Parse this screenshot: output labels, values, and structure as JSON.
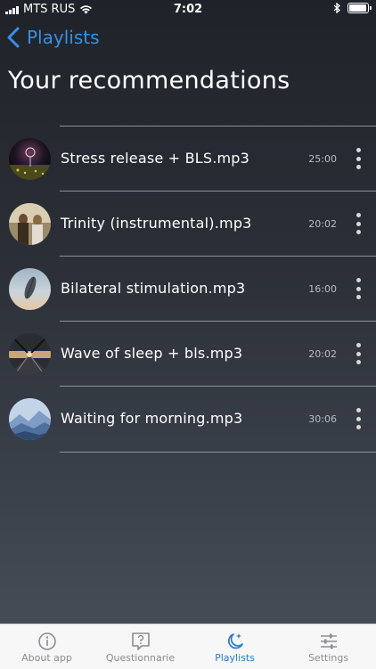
{
  "status": {
    "carrier": "MTS RUS",
    "time": "7:02",
    "battery_level": 0.95
  },
  "nav": {
    "back_label": "Playlists"
  },
  "page": {
    "title": "Your recommendations"
  },
  "tracks": [
    {
      "title": "Stress release + BLS.mp3",
      "duration": "25:00",
      "thumb": "dandelion-thumbnail"
    },
    {
      "title": "Trinity (instrumental).mp3",
      "duration": "20:02",
      "thumb": "women-thumbnail"
    },
    {
      "title": "Bilateral stimulation.mp3",
      "duration": "16:00",
      "thumb": "feather-thumbnail"
    },
    {
      "title": "Wave of sleep + bls.mp3",
      "duration": "20:02",
      "thumb": "pier-sunset-thumbnail"
    },
    {
      "title": "Waiting for morning.mp3",
      "duration": "30:06",
      "thumb": "mountains-thumbnail"
    }
  ],
  "tabs": [
    {
      "label": "About app",
      "icon": "info-icon"
    },
    {
      "label": "Questionnarie",
      "icon": "question-icon"
    },
    {
      "label": "Playlists",
      "icon": "moon-stars-icon",
      "active": true
    },
    {
      "label": "Settings",
      "icon": "sliders-icon"
    }
  ],
  "colors": {
    "accent": "#2d7ad6",
    "back": "#3b8fe0"
  }
}
